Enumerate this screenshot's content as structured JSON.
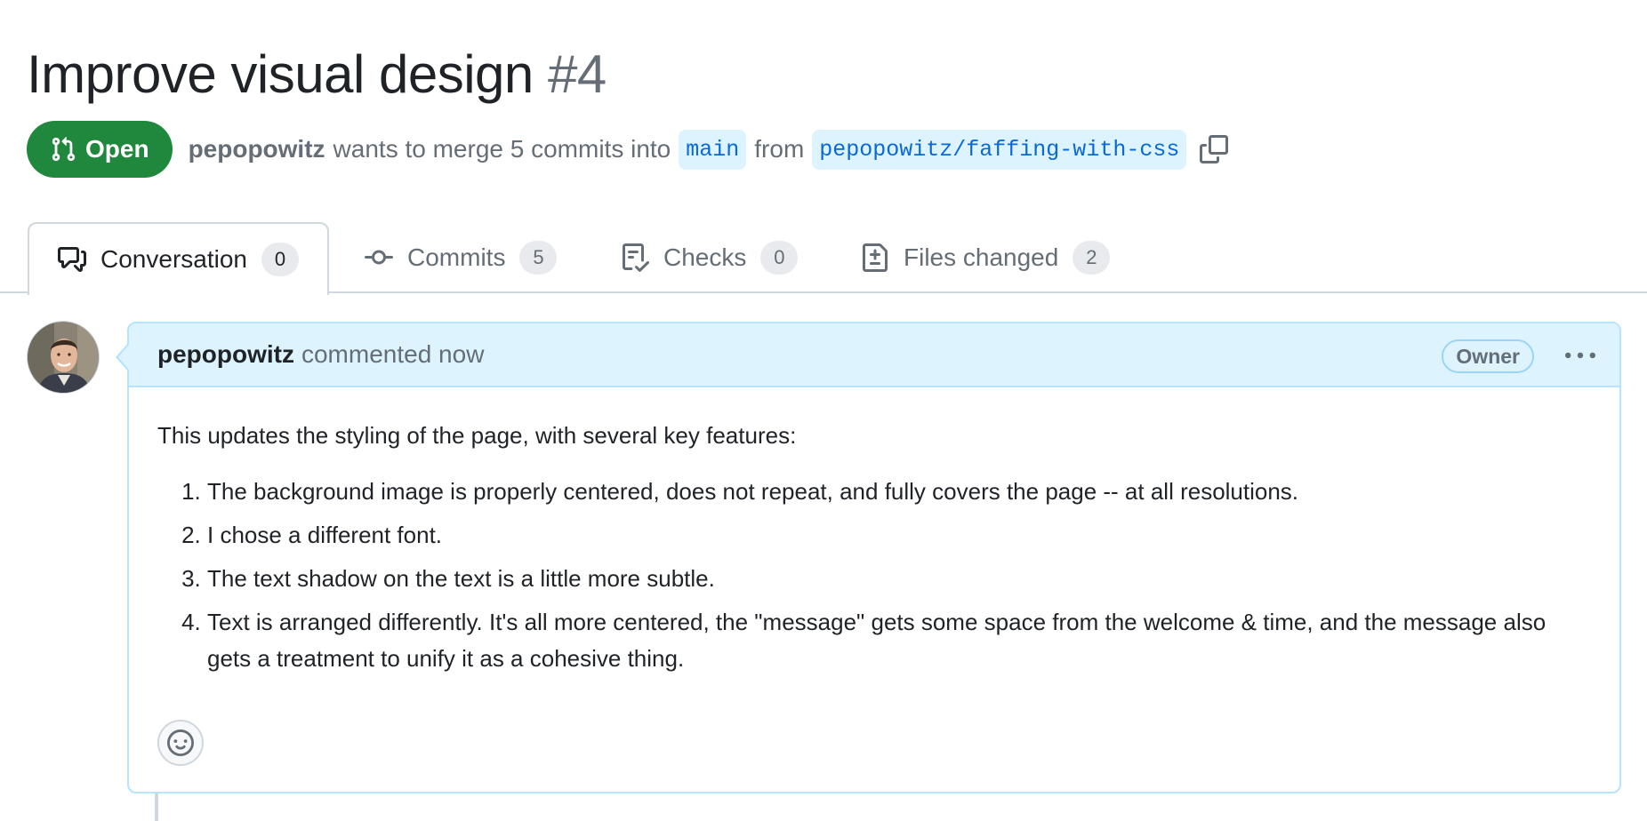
{
  "pr": {
    "title": "Improve visual design",
    "number": "#4",
    "state": "Open",
    "author": "pepopowitz",
    "merge_text": "wants to merge 5 commits into",
    "base_branch": "main",
    "from_text": "from",
    "head_branch": "pepopowitz/faffing-with-css"
  },
  "tabs": [
    {
      "label": "Conversation",
      "count": "0",
      "icon": "comment-discussion-icon"
    },
    {
      "label": "Commits",
      "count": "5",
      "icon": "git-commit-icon"
    },
    {
      "label": "Checks",
      "count": "0",
      "icon": "checklist-icon"
    },
    {
      "label": "Files changed",
      "count": "2",
      "icon": "file-diff-icon"
    }
  ],
  "comment": {
    "author": "pepopowitz",
    "timestamp": "commented now",
    "role": "Owner",
    "intro": "This updates the styling of the page, with several key features:",
    "items": [
      "The background image is properly centered, does not repeat, and fully covers the page -- at all resolutions.",
      "I chose a different font.",
      "The text shadow on the text is a little more subtle.",
      "Text is arranged differently. It's all more centered, the \"message\" gets some space from the welcome & time, and the message also gets a treatment to unify it as a cohesive thing."
    ]
  },
  "colors": {
    "open_green": "#1f883d",
    "link_blue": "#0969da",
    "header_blue": "#ddf4ff",
    "border_blue": "#b6e3ff"
  }
}
